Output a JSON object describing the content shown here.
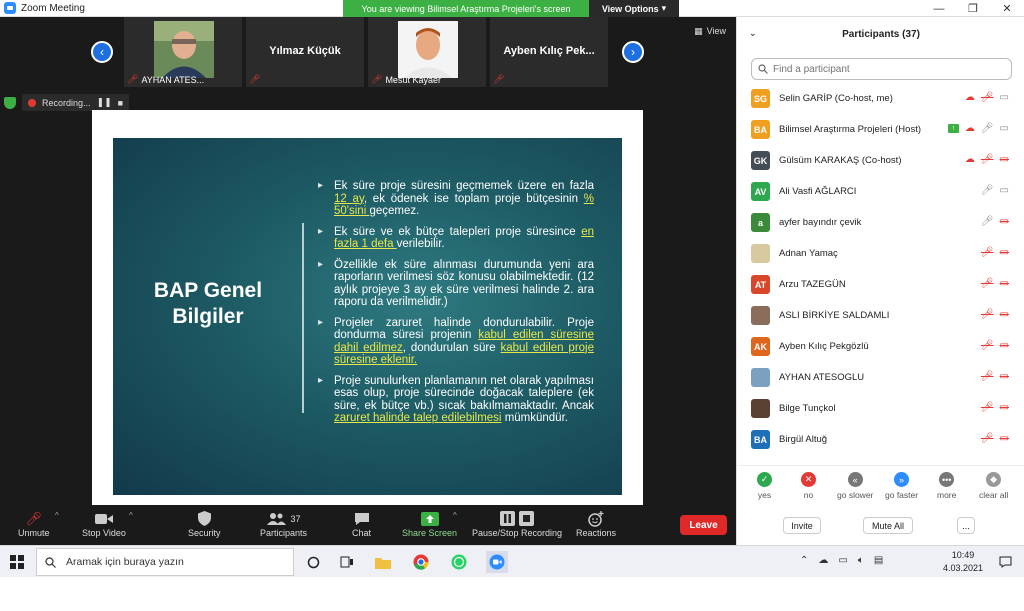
{
  "window": {
    "title": "Zoom Meeting",
    "viewing_banner": "You are viewing Bilimsel Araştırma Projeleri's screen",
    "view_options": "View Options",
    "min_glyph": "—",
    "restore_glyph": "❐",
    "close_glyph": "✕"
  },
  "thumbnails": {
    "prev_glyph": "‹",
    "next_glyph": "›",
    "view_label": "View",
    "items": [
      {
        "label": "AYHAN ATES...",
        "has_photo": true
      },
      {
        "label": "",
        "center_name": "Yılmaz Küçük",
        "has_photo": false
      },
      {
        "label": "Mesut Kayaer",
        "has_photo": true
      },
      {
        "label": "",
        "center_name": "Ayben Kılıç Pek...",
        "has_photo": false
      }
    ]
  },
  "recording": {
    "label": "Recording...",
    "pause_glyph": "❚❚",
    "stop_glyph": "■"
  },
  "slide": {
    "title_line1": "BAP Genel",
    "title_line2": "Bilgiler",
    "b1_t1": "Ek süre proje süresini geçmemek üzere en fazla ",
    "b1_h1": "12 ay",
    "b1_t2": ", ek ödenek ise toplam proje bütçesinin ",
    "b1_h2": "% 50'sini ",
    "b1_t3": "geçemez.",
    "b2_t1": "Ek süre ve ek bütçe talepleri proje süresince ",
    "b2_h1": "en fazla 1 defa ",
    "b2_t2": "verilebilir.",
    "b3_t1": "Özellikle ek süre alınması durumunda yeni ara raporların verilmesi söz konusu olabilmektedir. (12 aylık projeye 3 ay ek süre verilmesi halinde 2. ara raporu da verilmelidir.)",
    "b4_t1": "Projeler zaruret halinde dondurulabilir. Proje dondurma süresi projenin ",
    "b4_h1": "kabul edilen süresine dahil edilmez",
    "b4_t2": ", dondurulan süre ",
    "b4_h2": "kabul edilen proje süresine eklenir.",
    "b5_t1": "Proje sunulurken planlamanın net olarak yapılması esas olup, proje sürecinde doğacak taleplere (ek süre, ek bütçe vb.) sıcak bakılmamaktadır. Ancak ",
    "b5_h1": "zaruret halinde talep edilebilmesi",
    "b5_t2": " mümkündür."
  },
  "toolbar": {
    "unmute": "Unmute",
    "stop_video": "Stop Video",
    "security": "Security",
    "participants": "Participants",
    "participants_count": "37",
    "chat": "Chat",
    "share_screen": "Share Screen",
    "pause_stop_recording": "Pause/Stop Recording",
    "reactions": "Reactions",
    "leave": "Leave",
    "caret": "^"
  },
  "panel": {
    "title": "Participants (37)",
    "collapse_glyph": "⌄",
    "search_placeholder": "Find a participant",
    "participants": [
      {
        "initials": "SG",
        "color": "#f0a020",
        "name": "Selin GARİP (Co-host, me)"
      },
      {
        "initials": "BA",
        "color": "#f0a020",
        "name": "Bilimsel Araştırma Projeleri (Host)"
      },
      {
        "initials": "GK",
        "color": "#444c55",
        "name": "Gülsüm KARAKAŞ (Co-host)"
      },
      {
        "initials": "AV",
        "color": "#2ea84f",
        "name": "Ali Vasfi AĞLARCI"
      },
      {
        "initials": "a",
        "color": "#3a8a3a",
        "name": "ayfer bayındır çevik"
      },
      {
        "initials": "",
        "color": "#d9c9a0",
        "name": "Adnan Yamaç"
      },
      {
        "initials": "AT",
        "color": "#d9472b",
        "name": "Arzu TAZEGÜN"
      },
      {
        "initials": "",
        "color": "#8a6c5a",
        "name": "ASLI BİRKİYE SALDAMLI"
      },
      {
        "initials": "AK",
        "color": "#e0661e",
        "name": "Ayben Kılıç Pekgözlü"
      },
      {
        "initials": "",
        "color": "#7ba0c0",
        "name": "AYHAN ATESOGLU"
      },
      {
        "initials": "",
        "color": "#5a4030",
        "name": "Bilge Tunçkol"
      },
      {
        "initials": "BA",
        "color": "#1e6fb8",
        "name": "Birgül Altuğ"
      }
    ],
    "feedback": [
      {
        "label": "yes",
        "color": "#2ea84f",
        "glyph": "✓"
      },
      {
        "label": "no",
        "color": "#e53935",
        "glyph": "✕"
      },
      {
        "label": "go slower",
        "color": "#777",
        "glyph": "«"
      },
      {
        "label": "go faster",
        "color": "#2d8cff",
        "glyph": "»"
      },
      {
        "label": "more",
        "color": "#777",
        "glyph": "•••"
      },
      {
        "label": "clear all",
        "color": "#999",
        "glyph": "◆"
      }
    ],
    "invite": "Invite",
    "mute_all": "Mute All",
    "more": "..."
  },
  "taskbar": {
    "search_placeholder": "Aramak için buraya yazın",
    "time": "10:49",
    "date": "4.03.2021"
  }
}
